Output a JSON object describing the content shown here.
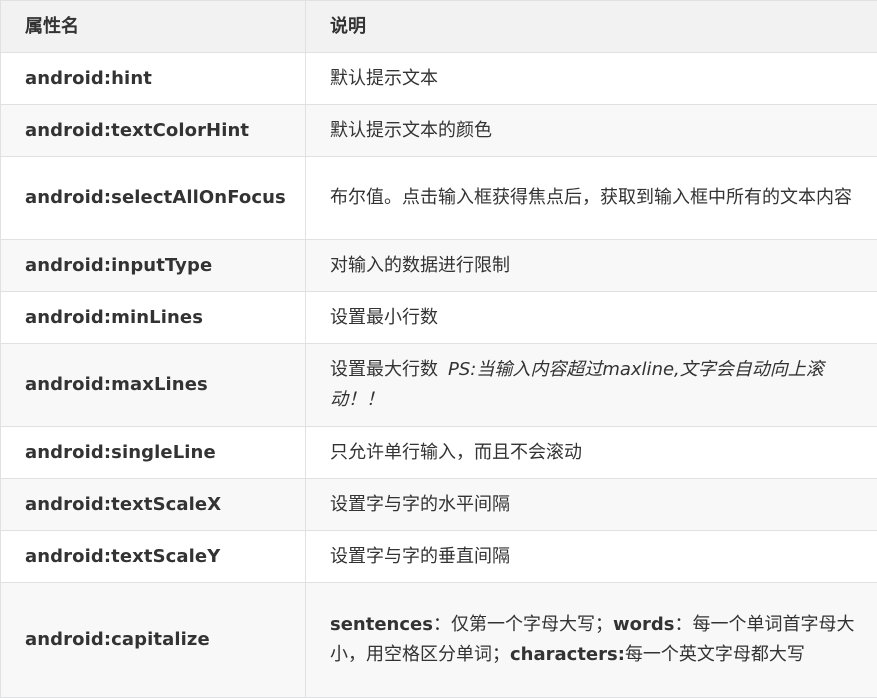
{
  "table": {
    "headers": [
      "属性名",
      "说明"
    ],
    "rows": [
      {
        "attr": "android:hint",
        "desc": "默认提示文本"
      },
      {
        "attr": "android:textColorHint",
        "desc": "默认提示文本的颜色"
      },
      {
        "attr": "android:selectAllOnFocus",
        "desc": "布尔值。点击输入框获得焦点后，获取到输入框中所有的文本内容"
      },
      {
        "attr": "android:inputType",
        "desc": "对输入的数据进行限制"
      },
      {
        "attr": "android:minLines",
        "desc": "设置最小行数"
      },
      {
        "attr": "android:maxLines",
        "desc": "设置最大行数",
        "note": "PS:当输入内容超过maxline,文字会自动向上滚动！！"
      },
      {
        "attr": "android:singleLine",
        "desc": "只允许单行输入，而且不会滚动"
      },
      {
        "attr": "android:textScaleX",
        "desc": "设置字与字的水平间隔"
      },
      {
        "attr": "android:textScaleY",
        "desc": "设置字与字的垂直间隔"
      },
      {
        "attr": "android:capitalize",
        "desc_parts": {
          "k1": "sentences",
          "t1": "：仅第一个字母大写；",
          "k2": "words",
          "t2": "：每一个单词首字母大小，用空格区分单词；",
          "k3": "characters:",
          "t3": "每一个英文字母都大写"
        }
      }
    ]
  }
}
